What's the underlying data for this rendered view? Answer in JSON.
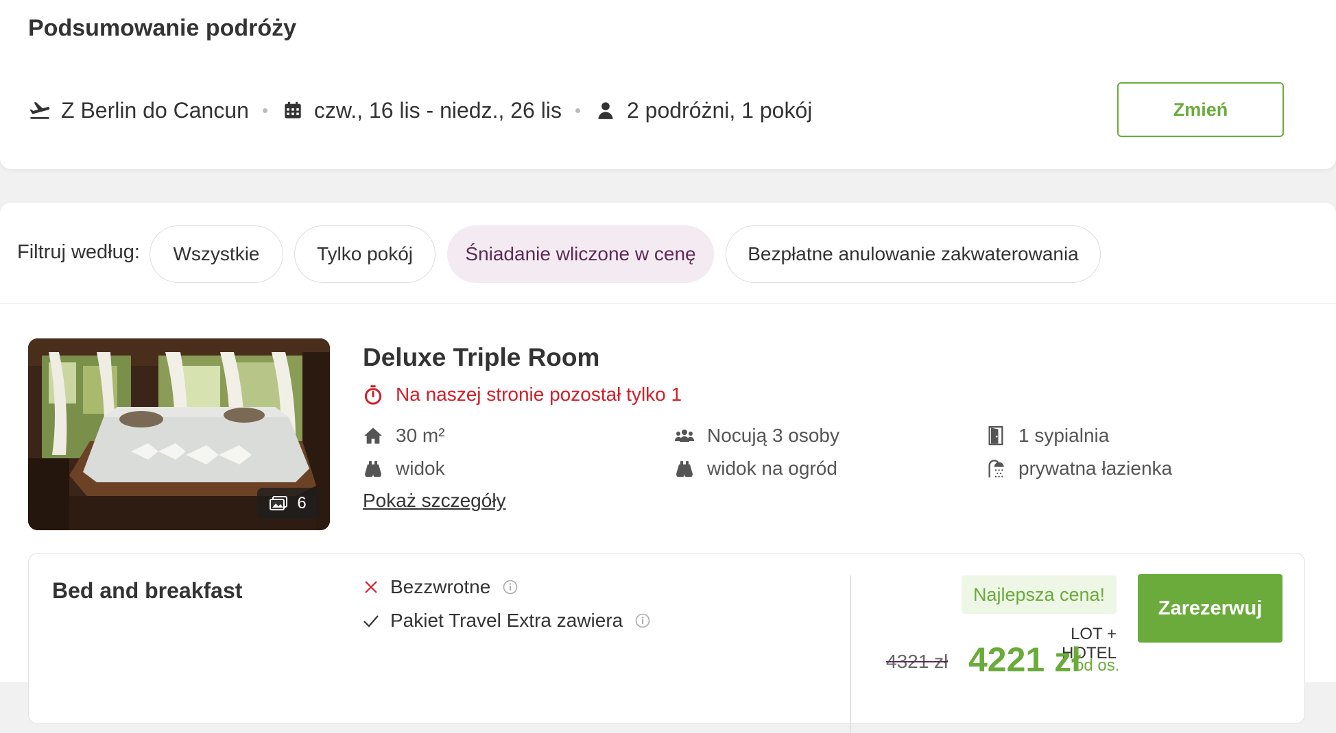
{
  "summary": {
    "title": "Podsumowanie podróży",
    "route": "Z Berlin do Cancun",
    "dates": "czw., 16 lis - niedz., 26 lis",
    "travellers": "2 podróżni, 1 pokój",
    "change_label": "Zmień"
  },
  "filters": {
    "label": "Filtruj według:",
    "options": [
      "Wszystkie",
      "Tylko pokój",
      "Śniadanie wliczone w cenę",
      "Bezpłatne anulowanie zakwaterowania"
    ],
    "active": "Śniadanie wliczone w cenę"
  },
  "room": {
    "title": "Deluxe Triple Room",
    "urgency": "Na naszej stronie pozostał tylko 1",
    "photo_count": "6",
    "features": {
      "size": "30 m²",
      "occupancy": "Nocują 3 osoby",
      "bedrooms": "1 sypialnia",
      "view": "widok",
      "garden_view": "widok na ogród",
      "bathroom": "prywatna łazienka"
    },
    "details_link": "Pokaż szczegóły"
  },
  "offer": {
    "name": "Bed and breakfast",
    "conditions": [
      {
        "text": "Bezzwrotne",
        "icon": "cross-icon"
      },
      {
        "text": "Pakiet Travel Extra zawiera",
        "icon": "check-icon"
      }
    ],
    "badge": "Najlepsza cena!",
    "book_label": "Zarezerwuj",
    "package": "LOT + HOTEL",
    "old_price": "4321 zł",
    "price": "4221 zł",
    "per_person": "od os."
  },
  "colors": {
    "accent_green": "#6aab3b",
    "urgency_red": "#d0202a",
    "active_filter_bg": "#f3ebf1",
    "active_filter_text": "#5e2a55"
  }
}
